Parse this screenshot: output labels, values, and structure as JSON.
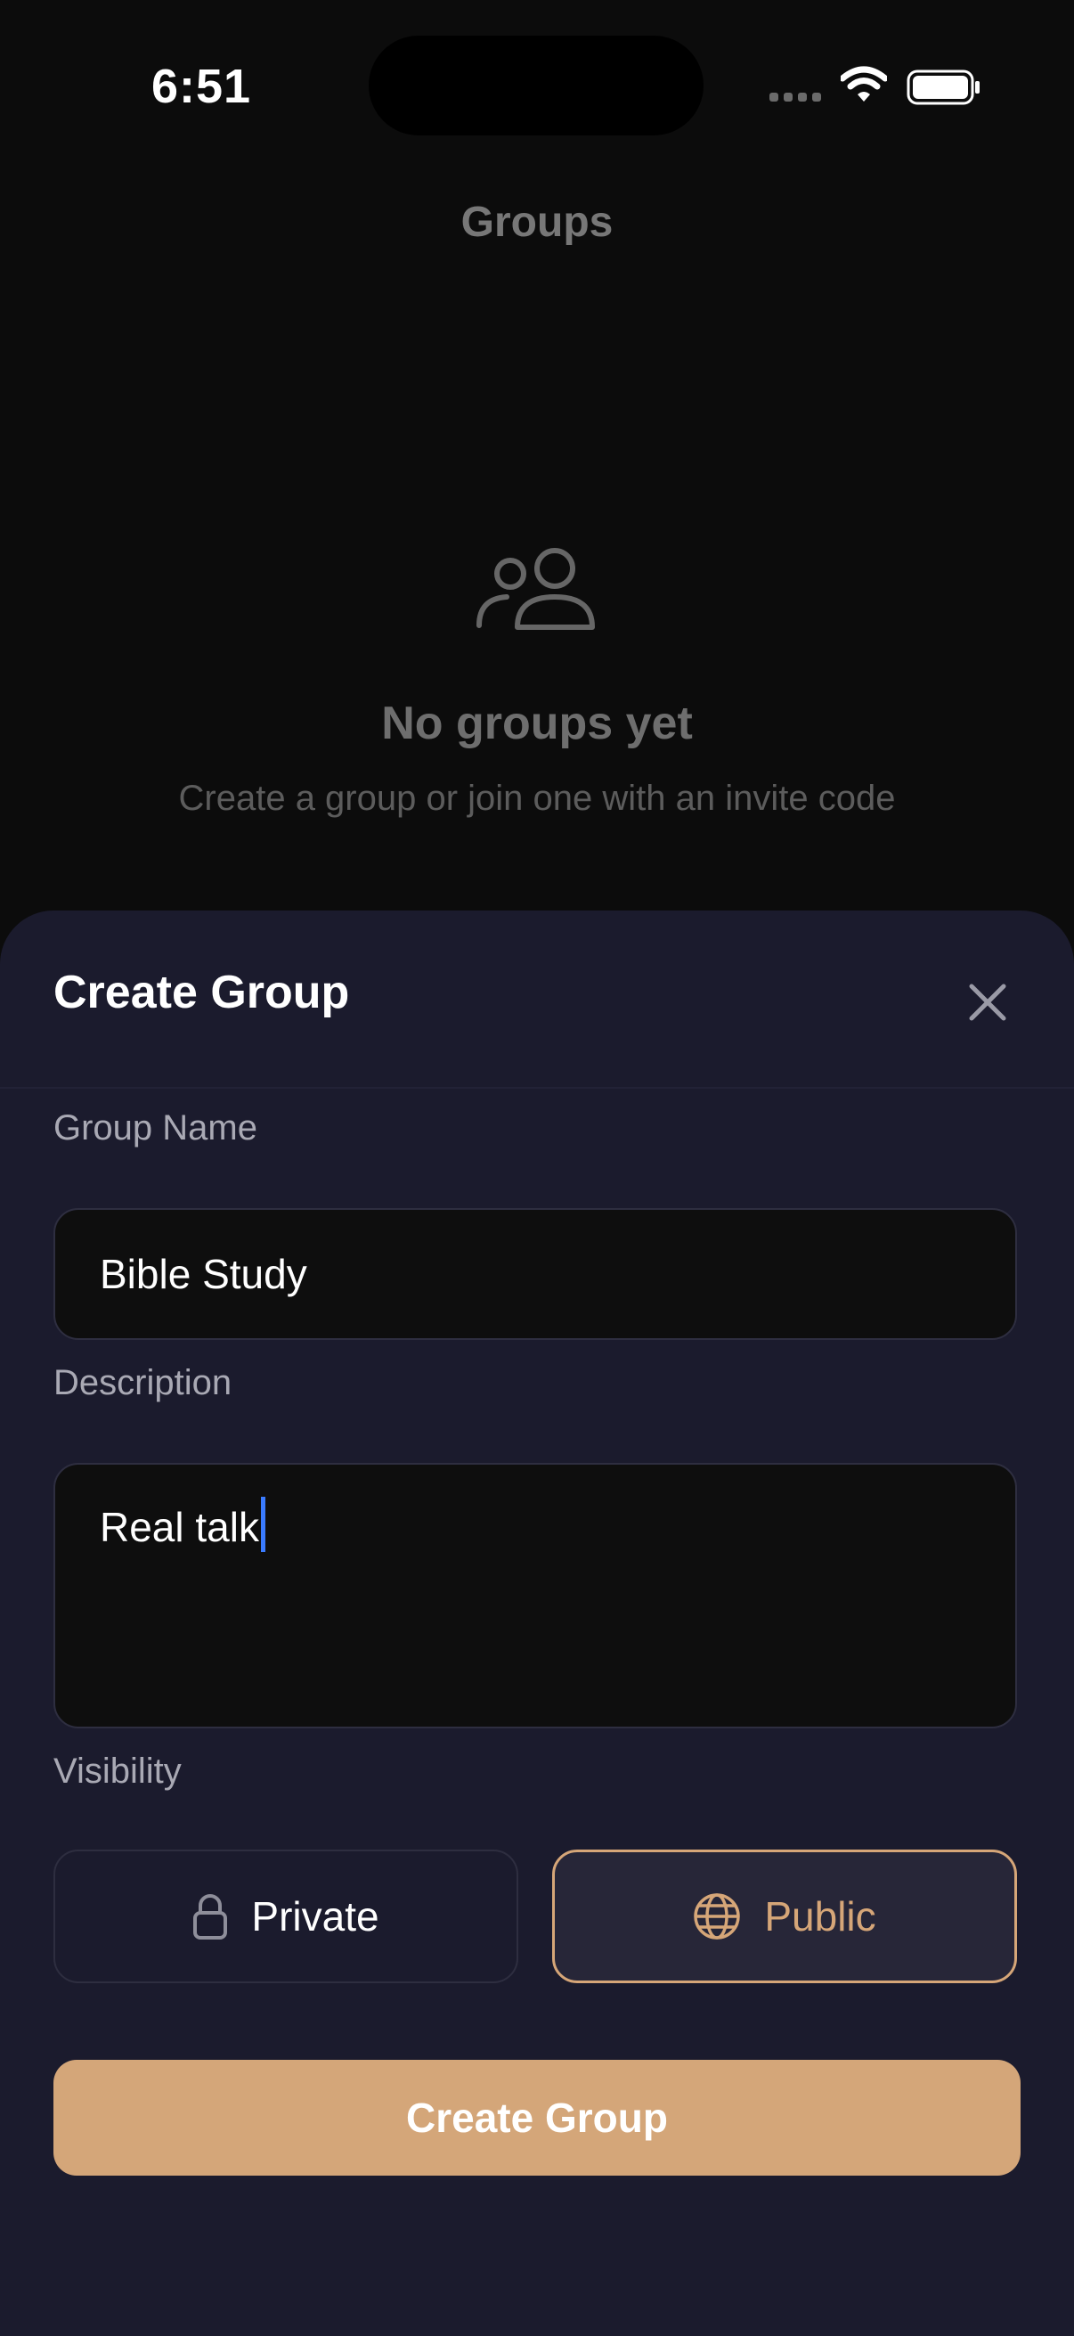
{
  "status_bar": {
    "time": "6:51",
    "icons": [
      "cellular-signal-icon",
      "wifi-icon",
      "battery-icon"
    ]
  },
  "background_page": {
    "title": "Groups",
    "empty_state": {
      "icon": "people-icon",
      "title": "No groups yet",
      "subtitle": "Create a group or join one with an invite code"
    }
  },
  "sheet": {
    "title": "Create Group",
    "close_icon": "close-icon",
    "group_name": {
      "label": "Group Name",
      "value": "Bible Study"
    },
    "description": {
      "label": "Description",
      "value": "Real talk"
    },
    "visibility": {
      "label": "Visibility",
      "options": [
        {
          "label": "Private",
          "icon": "lock-icon",
          "selected": false
        },
        {
          "label": "Public",
          "icon": "globe-icon",
          "selected": true
        }
      ]
    },
    "submit_label": "Create Group"
  },
  "colors": {
    "sheet_background": "#1b1b2d",
    "accent": "#d4a679",
    "caret": "#3a7bff"
  }
}
